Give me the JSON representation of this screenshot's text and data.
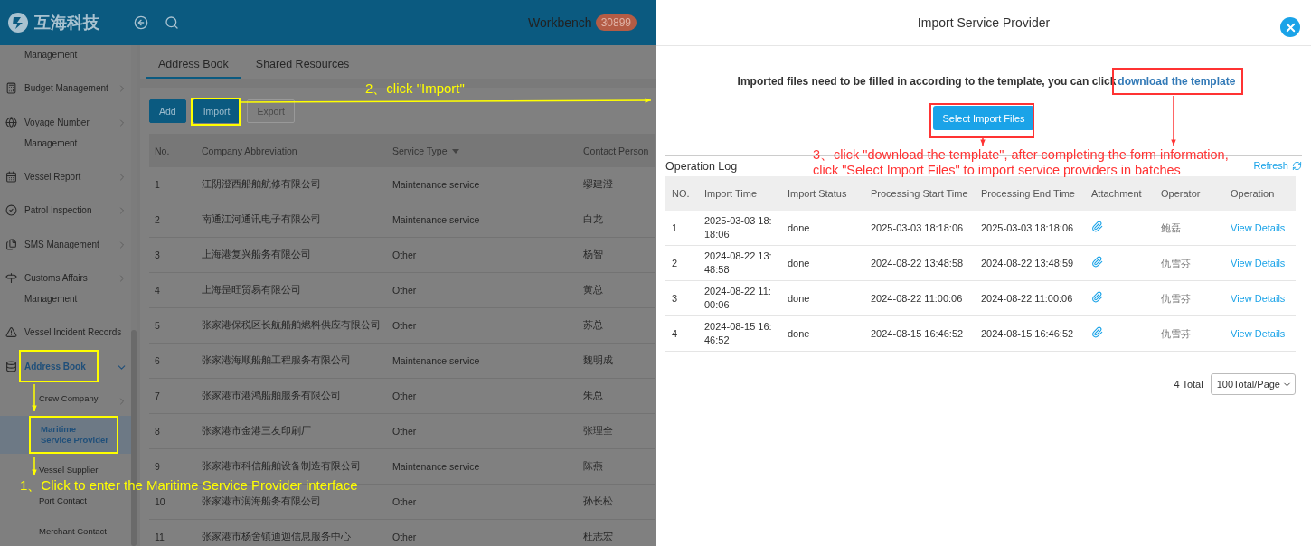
{
  "topbar": {
    "logo_text": "互海科技",
    "workbench": "Workbench",
    "badge": "30899"
  },
  "sidebar": {
    "items": [
      {
        "label": "Management"
      },
      {
        "label": "Budget Management",
        "expanded": false
      },
      {
        "label": "Voyage Number Management",
        "expanded": false
      },
      {
        "label": "Vessel Report",
        "expanded": false
      },
      {
        "label": "Patrol Inspection",
        "expanded": false
      },
      {
        "label": "SMS Management",
        "expanded": false
      },
      {
        "label": "Customs Affairs Management",
        "expanded": false
      },
      {
        "label": "Vessel Incident Records"
      },
      {
        "label": "Address Book",
        "expanded": true,
        "children": [
          {
            "label": "Crew Company",
            "selected": false,
            "expanded": false
          },
          {
            "label": "Maritime Service Provider",
            "selected": true
          },
          {
            "label": "Vessel Supplier",
            "selected": false
          },
          {
            "label": "Port Contact",
            "selected": false
          },
          {
            "label": "Merchant Contact",
            "selected": false
          }
        ]
      }
    ]
  },
  "tabs": [
    {
      "label": "Address Book",
      "selected": true
    },
    {
      "label": "Shared Resources",
      "selected": false
    }
  ],
  "toolbar": [
    {
      "label": "Add",
      "kind": "primary"
    },
    {
      "label": "Import",
      "kind": "primary"
    },
    {
      "label": "Export",
      "kind": "default"
    }
  ],
  "table": {
    "columns": [
      "No.",
      "Company Abbreviation",
      "Service Type",
      "Contact Person"
    ],
    "rows": [
      [
        "1",
        "江阴澄西船舶航修有限公司",
        "Maintenance service",
        "缪建澄"
      ],
      [
        "2",
        "南通江河通讯电子有限公司",
        "Maintenance service",
        "白龙"
      ],
      [
        "3",
        "上海港复兴船务有限公司",
        "Other",
        "杨智"
      ],
      [
        "4",
        "上海昰旺贸易有限公司",
        "Other",
        "黄总"
      ],
      [
        "5",
        "张家港保税区长航船舶燃料供应有限公司",
        "Other",
        "苏总"
      ],
      [
        "6",
        "张家港海顺船舶工程服务有限公司",
        "Maintenance service",
        "魏明成"
      ],
      [
        "7",
        "张家港市港鸿船舶服务有限公司",
        "Other",
        "朱总"
      ],
      [
        "8",
        "张家港市金港三友印刷厂",
        "Other",
        "张理全"
      ],
      [
        "9",
        "张家港市科信船舶设备制造有限公司",
        "Maintenance service",
        "陈燕"
      ],
      [
        "10",
        "张家港市润海船务有限公司",
        "Other",
        "孙长松"
      ],
      [
        "11",
        "张家港市杨舍镇迪迦信息服务中心",
        "Other",
        "杜志宏"
      ]
    ]
  },
  "drawer": {
    "title": "Import Service Provider",
    "instruction": "Imported files need to be filled in according to the template, you can click",
    "template_link": "download the template",
    "select_button": "Select Import Files",
    "log_title": "Operation Log",
    "refresh": "Refresh",
    "log_columns": [
      "NO.",
      "Import Time",
      "Import Status",
      "Processing Start Time",
      "Processing End Time",
      "Attachment",
      "Operator",
      "Operation"
    ],
    "log_rows": [
      {
        "no": "1",
        "import_time": "2025-03-03 18:18:06",
        "status": "done",
        "start": "2025-03-03 18:18:06",
        "end": "2025-03-03 18:18:06",
        "operator": "鲍磊",
        "action": "View Details"
      },
      {
        "no": "2",
        "import_time": "2024-08-22 13:48:58",
        "status": "done",
        "start": "2024-08-22 13:48:58",
        "end": "2024-08-22 13:48:59",
        "operator": "仇雪芬",
        "action": "View Details"
      },
      {
        "no": "3",
        "import_time": "2024-08-22 11:00:06",
        "status": "done",
        "start": "2024-08-22 11:00:06",
        "end": "2024-08-22 11:00:06",
        "operator": "仇雪芬",
        "action": "View Details"
      },
      {
        "no": "4",
        "import_time": "2024-08-15 16:46:52",
        "status": "done",
        "start": "2024-08-15 16:46:52",
        "end": "2024-08-15 16:46:52",
        "operator": "仇雪芬",
        "action": "View Details"
      }
    ],
    "total": "4 Total",
    "page_size": "100Total/Page"
  },
  "annotations": [
    {
      "text": "1、Click to enter the Maritime Service Provider interface",
      "color": "#ffff00"
    },
    {
      "text": "2、click \"Import\"",
      "color": "#ffff00"
    },
    {
      "text": "3、click \"download the template\", after completing the form information, click \"Select Import Files\" to import service providers in batches",
      "color": "#ff3333"
    }
  ]
}
